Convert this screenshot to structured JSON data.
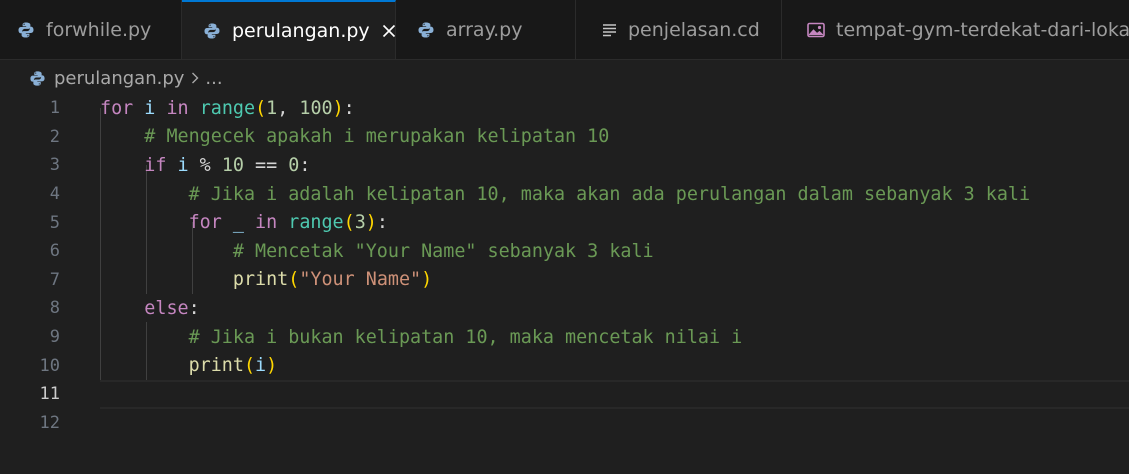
{
  "tabs": [
    {
      "label": "forwhile.py",
      "icon": "python-icon",
      "active": false
    },
    {
      "label": "perulangan.py",
      "icon": "python-icon",
      "active": true
    },
    {
      "label": "array.py",
      "icon": "python-icon",
      "active": false
    },
    {
      "label": "penjelasan.cd",
      "icon": "text-lines-icon",
      "active": false
    },
    {
      "label": "tempat-gym-terdekat-dari-lokasi-s",
      "icon": "image-icon",
      "active": false
    }
  ],
  "breadcrumb": {
    "file": "perulangan.py",
    "more": "..."
  },
  "lines": [
    {
      "n": "1",
      "tokens": [
        {
          "t": "for",
          "c": "kw"
        },
        {
          "t": " ",
          "c": "op"
        },
        {
          "t": "i",
          "c": "var"
        },
        {
          "t": " ",
          "c": "op"
        },
        {
          "t": "in",
          "c": "kw"
        },
        {
          "t": " ",
          "c": "op"
        },
        {
          "t": "range",
          "c": "bi"
        },
        {
          "t": "(",
          "c": "br1"
        },
        {
          "t": "1",
          "c": "num"
        },
        {
          "t": ", ",
          "c": "op"
        },
        {
          "t": "100",
          "c": "num"
        },
        {
          "t": ")",
          "c": "br1"
        },
        {
          "t": ":",
          "c": "op"
        }
      ]
    },
    {
      "n": "2",
      "tokens": [
        {
          "t": "    ",
          "c": "op"
        },
        {
          "t": "# Mengecek apakah i merupakan kelipatan 10",
          "c": "cm"
        }
      ]
    },
    {
      "n": "3",
      "tokens": [
        {
          "t": "    ",
          "c": "op"
        },
        {
          "t": "if",
          "c": "kw"
        },
        {
          "t": " ",
          "c": "op"
        },
        {
          "t": "i",
          "c": "var"
        },
        {
          "t": " % ",
          "c": "op"
        },
        {
          "t": "10",
          "c": "num"
        },
        {
          "t": " == ",
          "c": "op"
        },
        {
          "t": "0",
          "c": "num"
        },
        {
          "t": ":",
          "c": "op"
        }
      ]
    },
    {
      "n": "4",
      "tokens": [
        {
          "t": "        ",
          "c": "op"
        },
        {
          "t": "# Jika i adalah kelipatan 10, maka akan ada perulangan dalam sebanyak 3 kali",
          "c": "cm"
        }
      ]
    },
    {
      "n": "5",
      "tokens": [
        {
          "t": "        ",
          "c": "op"
        },
        {
          "t": "for",
          "c": "kw"
        },
        {
          "t": " ",
          "c": "op"
        },
        {
          "t": "_",
          "c": "var"
        },
        {
          "t": " ",
          "c": "op"
        },
        {
          "t": "in",
          "c": "kw"
        },
        {
          "t": " ",
          "c": "op"
        },
        {
          "t": "range",
          "c": "bi"
        },
        {
          "t": "(",
          "c": "br1"
        },
        {
          "t": "3",
          "c": "num"
        },
        {
          "t": ")",
          "c": "br1"
        },
        {
          "t": ":",
          "c": "op"
        }
      ]
    },
    {
      "n": "6",
      "tokens": [
        {
          "t": "            ",
          "c": "op"
        },
        {
          "t": "# Mencetak \"Your Name\" sebanyak 3 kali",
          "c": "cm"
        }
      ]
    },
    {
      "n": "7",
      "tokens": [
        {
          "t": "            ",
          "c": "op"
        },
        {
          "t": "print",
          "c": "fn"
        },
        {
          "t": "(",
          "c": "br1"
        },
        {
          "t": "\"Your Name\"",
          "c": "str"
        },
        {
          "t": ")",
          "c": "br1"
        }
      ]
    },
    {
      "n": "8",
      "tokens": [
        {
          "t": "    ",
          "c": "op"
        },
        {
          "t": "else",
          "c": "kw"
        },
        {
          "t": ":",
          "c": "op"
        }
      ]
    },
    {
      "n": "9",
      "tokens": [
        {
          "t": "        ",
          "c": "op"
        },
        {
          "t": "# Jika i bukan kelipatan 10, maka mencetak nilai i",
          "c": "cm"
        }
      ]
    },
    {
      "n": "10",
      "tokens": [
        {
          "t": "        ",
          "c": "op"
        },
        {
          "t": "print",
          "c": "fn"
        },
        {
          "t": "(",
          "c": "br1"
        },
        {
          "t": "i",
          "c": "var"
        },
        {
          "t": ")",
          "c": "br1"
        }
      ]
    },
    {
      "n": "11",
      "tokens": [],
      "current": true
    },
    {
      "n": "12",
      "tokens": []
    }
  ]
}
